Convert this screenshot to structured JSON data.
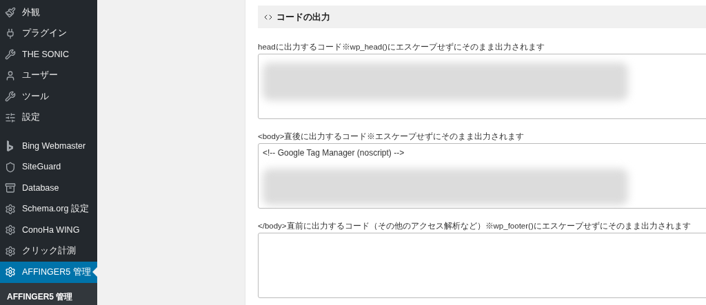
{
  "sidebar": {
    "groups": [
      [
        {
          "label": "外観",
          "selected": false
        },
        {
          "label": "プラグイン",
          "selected": false
        },
        {
          "label": "THE SONIC",
          "selected": false
        },
        {
          "label": "ユーザー",
          "selected": false
        },
        {
          "label": "ツール",
          "selected": false
        },
        {
          "label": "設定",
          "selected": false
        }
      ],
      [
        {
          "label": "Bing Webmaster",
          "selected": false
        },
        {
          "label": "SiteGuard",
          "selected": false
        },
        {
          "label": "Database",
          "selected": false
        },
        {
          "label": "Schema.org 設定",
          "selected": false
        },
        {
          "label": "ConoHa WING",
          "selected": false
        },
        {
          "label": "クリック計測",
          "selected": false
        },
        {
          "label": "AFFINGER5 管理",
          "selected": true
        }
      ]
    ],
    "submenu": [
      {
        "label": "AFFINGER5 管理",
        "selected": true
      }
    ]
  },
  "section": {
    "title": "コードの出力",
    "fields": [
      {
        "label": "headに出力するコード※wp_head()にエスケープせずにそのまま出力されます",
        "blurred": true
      },
      {
        "label": "<body>直後に出力するコード※エスケープせずにそのまま出力されます",
        "value": "<!-- Google Tag Manager (noscript) -->",
        "blurred": true
      },
      {
        "label": "</body>直前に出力するコード（その他のアクセス解析など）※wp_footer()にエスケープせずにそのまま出力されます",
        "blurred": false
      }
    ]
  }
}
